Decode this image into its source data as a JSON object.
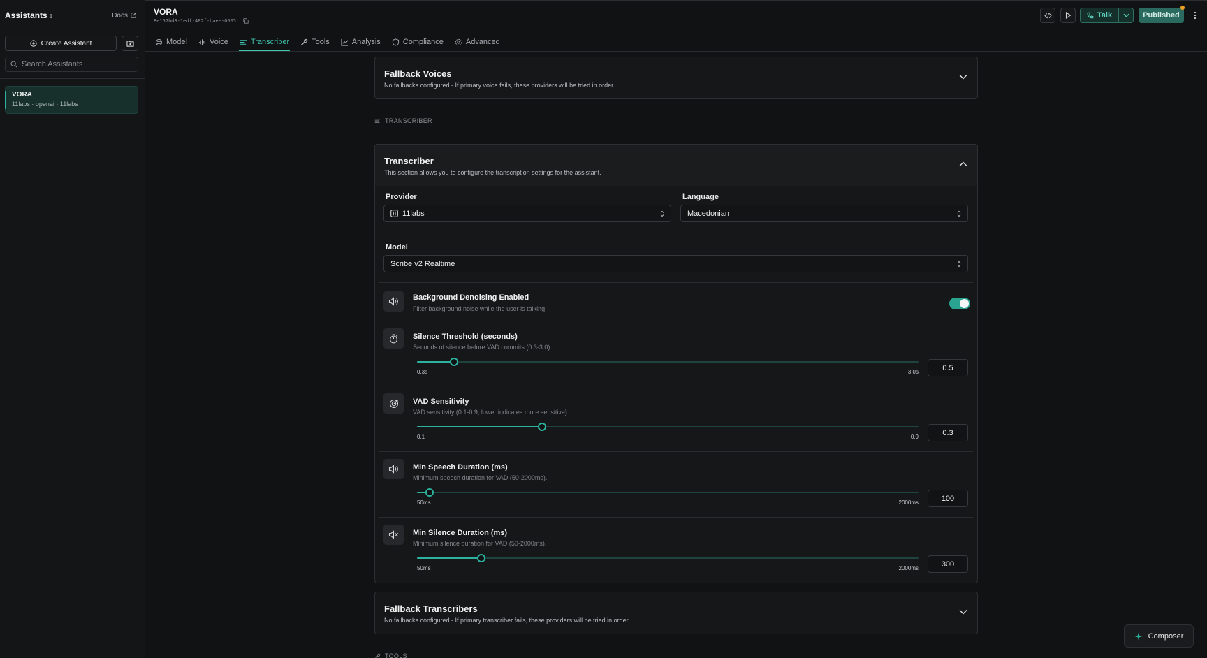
{
  "sidebar": {
    "title": "Assistants",
    "count": "1",
    "docs_label": "Docs",
    "create_label": "Create Assistant",
    "search_placeholder": "Search Assistants",
    "assistants": [
      {
        "name": "VORA",
        "subtitle": "11labs · openai · 11labs"
      }
    ]
  },
  "header": {
    "title": "VORA",
    "id": "8e157bd3-1edf-482f-baee-0605…",
    "talk_label": "Talk",
    "published_label": "Published"
  },
  "tabs": [
    {
      "label": "Model",
      "icon": "brain-icon"
    },
    {
      "label": "Voice",
      "icon": "waveform-icon"
    },
    {
      "label": "Transcriber",
      "icon": "lines-icon",
      "active": true
    },
    {
      "label": "Tools",
      "icon": "wrench-icon"
    },
    {
      "label": "Analysis",
      "icon": "chart-icon"
    },
    {
      "label": "Compliance",
      "icon": "shield-icon"
    },
    {
      "label": "Advanced",
      "icon": "gear-icon"
    }
  ],
  "fallback_voices": {
    "title": "Fallback Voices",
    "desc": "No fallbacks configured - If primary voice fails, these providers will be tried in order."
  },
  "section_transcriber": "TRANSCRIBER",
  "section_tools": "TOOLS",
  "transcriber": {
    "title": "Transcriber",
    "desc": "This section allows you to configure the transcription settings for the assistant.",
    "provider_label": "Provider",
    "provider_value": "11labs",
    "language_label": "Language",
    "language_value": "Macedonian",
    "model_label": "Model",
    "model_value": "Scribe v2 Realtime",
    "denoise": {
      "title": "Background Denoising Enabled",
      "desc": "Filter background noise while the user is talking.",
      "enabled": true
    },
    "sliders": [
      {
        "title": "Silence Threshold (seconds)",
        "desc": "Seconds of silence before VAD commits (0.3-3.0).",
        "min_label": "0.3s",
        "max_label": "3.0s",
        "min": 0.3,
        "max": 3.0,
        "value": "0.5",
        "icon": "timer-icon"
      },
      {
        "title": "VAD Sensitivity",
        "desc": "VAD sensitivity (0.1-0.9, lower indicates more sensitive).",
        "min_label": "0.1",
        "max_label": "0.9",
        "min": 0.1,
        "max": 0.9,
        "value": "0.3",
        "icon": "target-icon"
      },
      {
        "title": "Min Speech Duration (ms)",
        "desc": "Minimum speech duration for VAD (50-2000ms).",
        "min_label": "50ms",
        "max_label": "2000ms",
        "min": 50,
        "max": 2000,
        "value": "100",
        "icon": "speaker-icon"
      },
      {
        "title": "Min Silence Duration (ms)",
        "desc": "Minimum silence duration for VAD (50-2000ms).",
        "min_label": "50ms",
        "max_label": "2000ms",
        "min": 50,
        "max": 2000,
        "value": "300",
        "icon": "mute-icon"
      }
    ]
  },
  "fallback_transcribers": {
    "title": "Fallback Transcribers",
    "desc": "No fallbacks configured - If primary transcriber fails, these providers will be tried in order."
  },
  "composer_label": "Composer",
  "colors": {
    "accent": "#2bb3a0",
    "background": "#111213",
    "published": "#2a6a5f",
    "badge": "#f0a020"
  }
}
